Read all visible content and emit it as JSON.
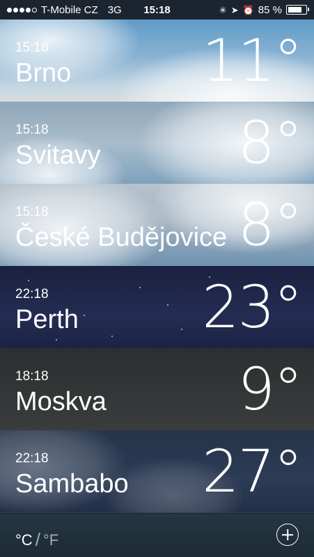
{
  "status_bar": {
    "carrier": "T-Mobile CZ",
    "network": "3G",
    "time": "15:18",
    "battery": "85 %",
    "battery_level": 0.85,
    "signal_bars_filled": 4,
    "signal_bars_total": 5,
    "icons": [
      "activity-spinner-icon",
      "location-arrow-icon",
      "alarm-clock-icon"
    ]
  },
  "cities": [
    {
      "time": "15:18",
      "name": "Brno",
      "temp": "11°",
      "theme": "cloudy-day"
    },
    {
      "time": "15:18",
      "name": "Svitavy",
      "temp": "8°",
      "theme": "cloudy-day"
    },
    {
      "time": "15:18",
      "name": "České Budějovice",
      "temp": "8°",
      "theme": "cloudy-day"
    },
    {
      "time": "22:18",
      "name": "Perth",
      "temp": "23°",
      "theme": "clear-night"
    },
    {
      "time": "18:18",
      "name": "Moskva",
      "temp": "9°",
      "theme": "overcast-dusk"
    },
    {
      "time": "22:18",
      "name": "Sambabo",
      "temp": "27°",
      "theme": "cloudy-night"
    }
  ],
  "bottom_bar": {
    "celsius_label": "°C",
    "separator": "/",
    "fahrenheit_label": "°F",
    "add_icon": "plus-circle-icon"
  }
}
